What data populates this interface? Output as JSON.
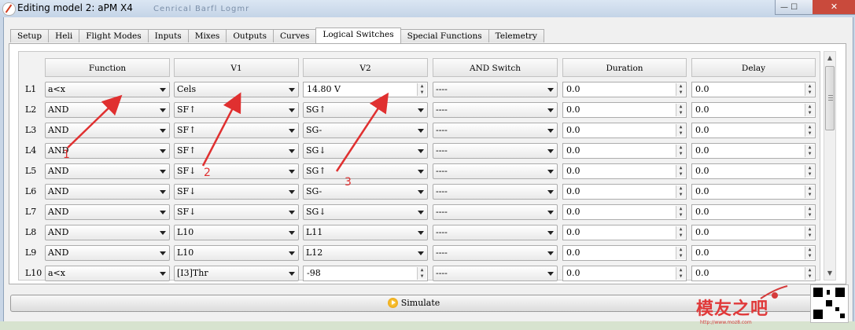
{
  "window": {
    "title": "Editing model 2: aPM  X4",
    "background_text": "Cenrical  Barfl Logmr",
    "close_label": "✕"
  },
  "tabs": [
    "Setup",
    "Heli",
    "Flight Modes",
    "Inputs",
    "Mixes",
    "Outputs",
    "Curves",
    "Logical Switches",
    "Special Functions",
    "Telemetry"
  ],
  "active_tab": "Logical Switches",
  "columns": [
    "Function",
    "V1",
    "V2",
    "AND Switch",
    "Duration",
    "Delay"
  ],
  "rows": [
    {
      "label": "L1",
      "function": "a<x",
      "v1": "Cels",
      "v2": "14.80 V",
      "v2_type": "spin",
      "and_switch": "----",
      "duration": "0.0",
      "delay": "0.0"
    },
    {
      "label": "L2",
      "function": "AND",
      "v1": "SF↑",
      "v2": "SG↑",
      "v2_type": "combo",
      "and_switch": "----",
      "duration": "0.0",
      "delay": "0.0"
    },
    {
      "label": "L3",
      "function": "AND",
      "v1": "SF↑",
      "v2": "SG-",
      "v2_type": "combo",
      "and_switch": "----",
      "duration": "0.0",
      "delay": "0.0"
    },
    {
      "label": "L4",
      "function": "AND",
      "v1": "SF↑",
      "v2": "SG↓",
      "v2_type": "combo",
      "and_switch": "----",
      "duration": "0.0",
      "delay": "0.0"
    },
    {
      "label": "L5",
      "function": "AND",
      "v1": "SF↓",
      "v2": "SG↑",
      "v2_type": "combo",
      "and_switch": "----",
      "duration": "0.0",
      "delay": "0.0"
    },
    {
      "label": "L6",
      "function": "AND",
      "v1": "SF↓",
      "v2": "SG-",
      "v2_type": "combo",
      "and_switch": "----",
      "duration": "0.0",
      "delay": "0.0"
    },
    {
      "label": "L7",
      "function": "AND",
      "v1": "SF↓",
      "v2": "SG↓",
      "v2_type": "combo",
      "and_switch": "----",
      "duration": "0.0",
      "delay": "0.0"
    },
    {
      "label": "L8",
      "function": "AND",
      "v1": "L10",
      "v2": "L11",
      "v2_type": "combo",
      "and_switch": "----",
      "duration": "0.0",
      "delay": "0.0"
    },
    {
      "label": "L9",
      "function": "AND",
      "v1": "L10",
      "v2": "L12",
      "v2_type": "combo",
      "and_switch": "----",
      "duration": "0.0",
      "delay": "0.0"
    },
    {
      "label": "L10",
      "function": "a<x",
      "v1": "[I3]Thr",
      "v2": "-98",
      "v2_type": "spin",
      "and_switch": "----",
      "duration": "0.0",
      "delay": "0.0"
    }
  ],
  "annotations": [
    "1",
    "2",
    "3"
  ],
  "simulate_label": "Simulate",
  "watermark": {
    "text": "模友之吧",
    "url": "http://www.moz8.com"
  },
  "colors": {
    "annotation": "#e03030",
    "title_bar": "#c4d4e7",
    "simulate_icon": "#e69a06"
  }
}
